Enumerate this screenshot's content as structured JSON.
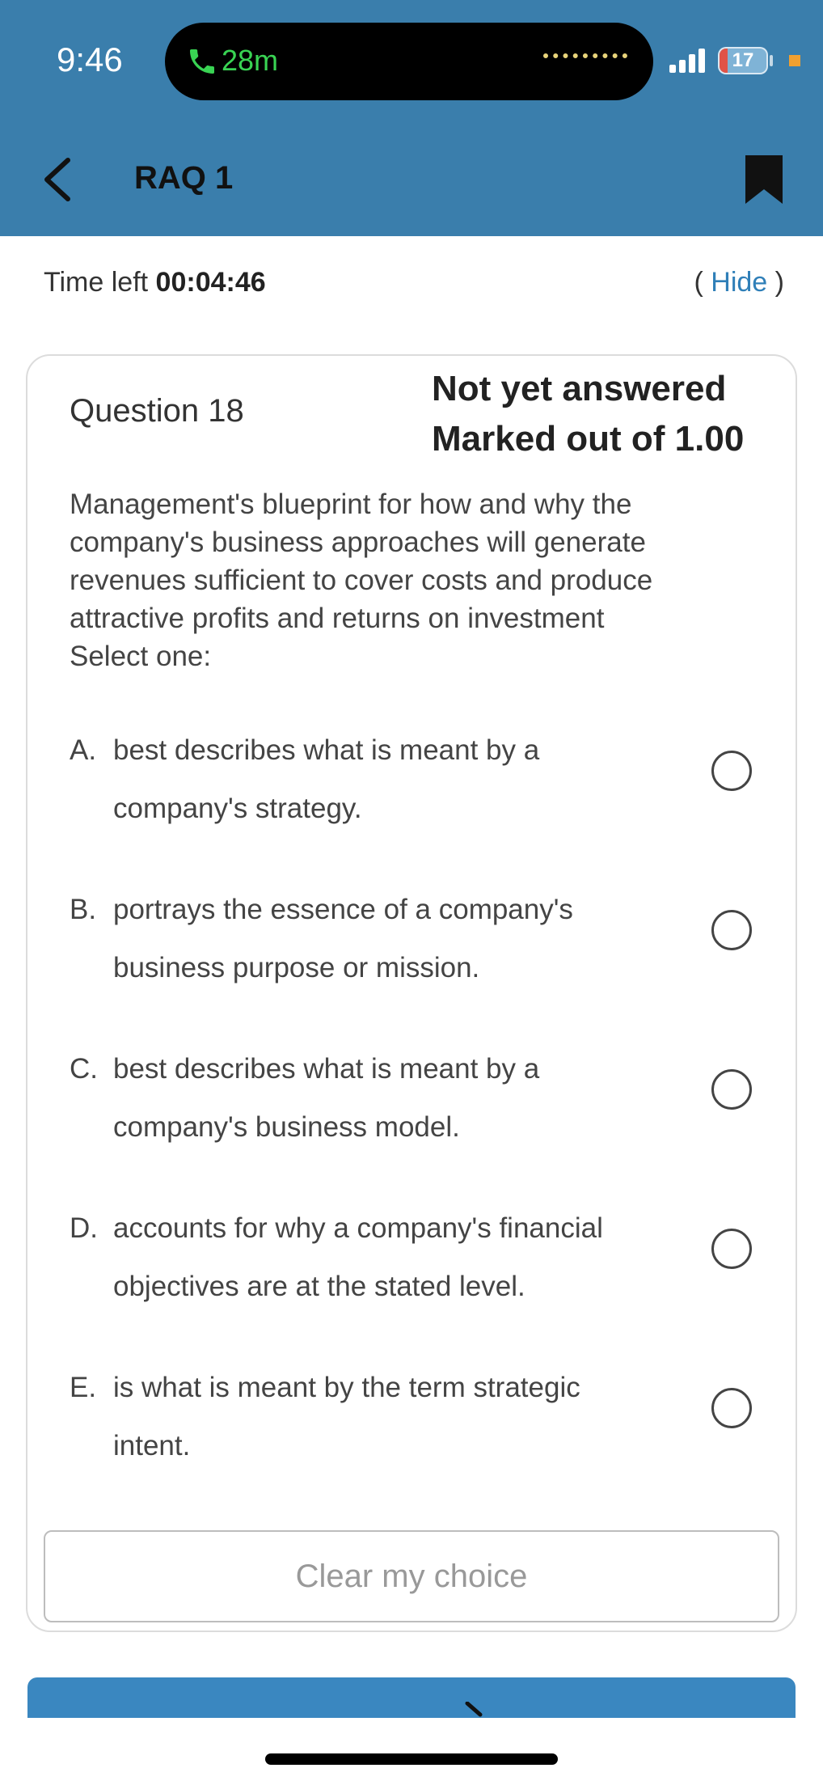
{
  "status_bar": {
    "time": "9:46",
    "call_duration": "28m",
    "battery_level": "17",
    "battery_fraction": 0.17
  },
  "nav": {
    "title": "RAQ 1",
    "back_icon": "chevron-left-icon",
    "bookmark_icon": "bookmark-icon"
  },
  "timer": {
    "label": "Time left",
    "value": "00:04:46",
    "hide_open": "(",
    "hide_label": "Hide",
    "hide_close": ")"
  },
  "question": {
    "number_label": "Question 18",
    "state": "Not yet answered",
    "marks": "Marked out of 1.00",
    "text": "Management's blueprint for how and why the company's business approaches will generate revenues sufficient to cover costs and produce attractive profits and returns on investment",
    "prompt": "Select one:",
    "options": [
      {
        "letter": "A.",
        "text": "best describes what is meant by a company's strategy."
      },
      {
        "letter": "B.",
        "text": "portrays the essence of a company's business purpose or mission."
      },
      {
        "letter": "C.",
        "text": "best describes what is meant by a company's business model."
      },
      {
        "letter": "D.",
        "text": "accounts for why a company's financial objectives are at the stated level."
      },
      {
        "letter": "E.",
        "text": "is what is meant by the term strategic intent."
      }
    ],
    "clear_label": "Clear my choice"
  },
  "colors": {
    "header": "#3a7eac",
    "link": "#2f7fb8",
    "call_green": "#39d353"
  }
}
